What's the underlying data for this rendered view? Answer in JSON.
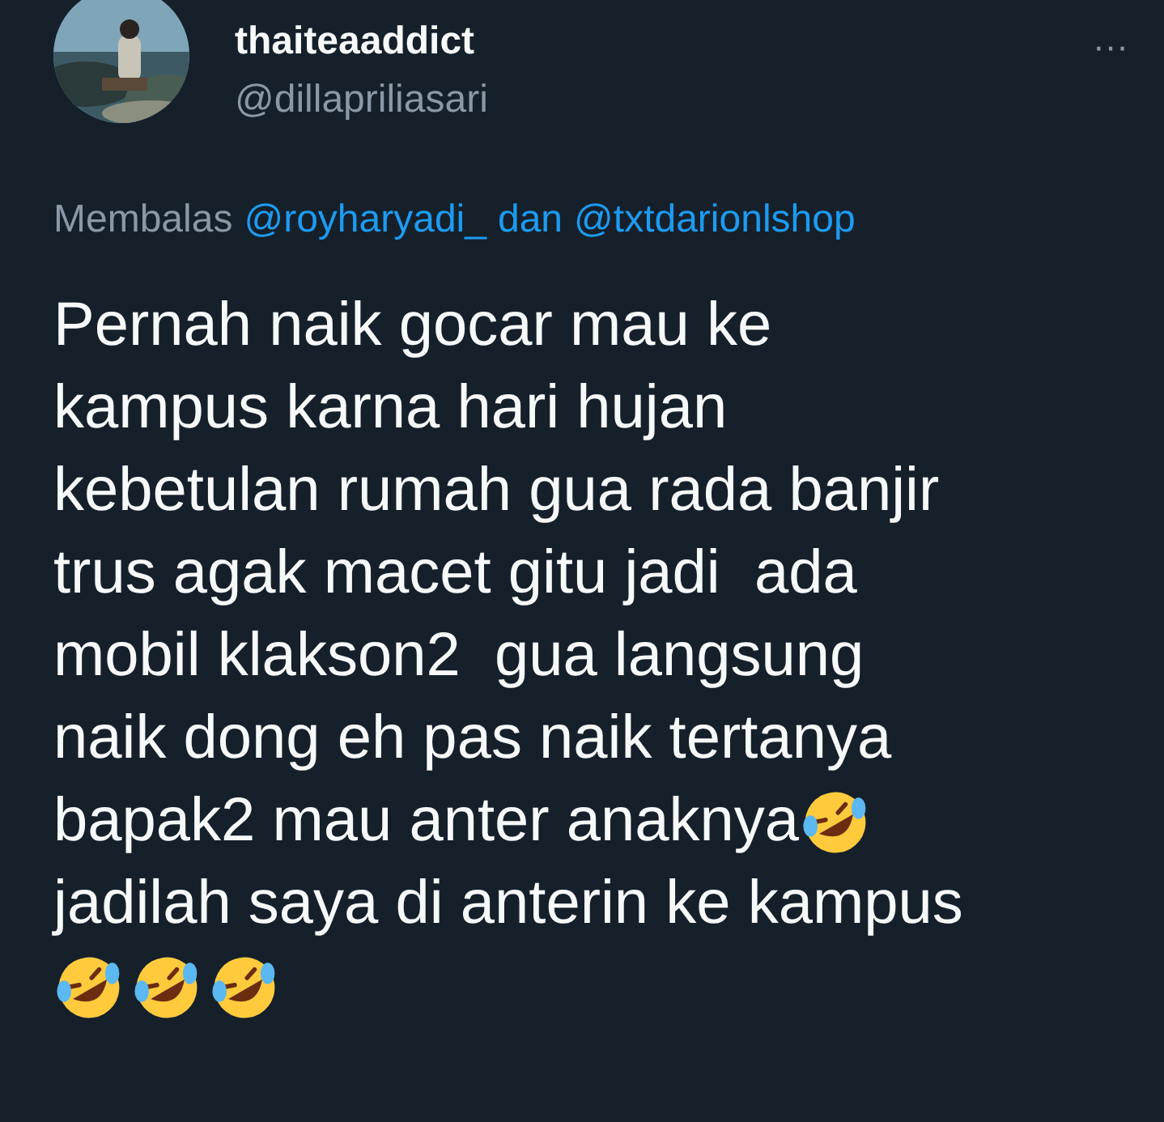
{
  "author": {
    "name": "thaiteaaddict",
    "handle": "@dillapriliasari",
    "more": "···"
  },
  "reply_to": {
    "prefix": "Membalas",
    "mentions": [
      "@royharyadi_",
      "@txtdarionlshop"
    ],
    "joiner": "dan"
  },
  "body": [
    [
      {
        "kind": "text",
        "text": "Pernah naik gocar mau ke"
      }
    ],
    [
      {
        "kind": "text",
        "text": "kampus karna hari hujan"
      }
    ],
    [
      {
        "kind": "text",
        "text": "kebetulan rumah gua rada banjir"
      }
    ],
    [
      {
        "kind": "text",
        "text": "trus agak macet gitu jadi  ada"
      }
    ],
    [
      {
        "kind": "text",
        "text": "mobil klakson2  gua langsung"
      }
    ],
    [
      {
        "kind": "text",
        "text": "naik dong eh pas naik tertanya"
      }
    ],
    [
      {
        "kind": "text",
        "text": "bapak2 mau anter anaknya"
      },
      {
        "kind": "emoji"
      }
    ],
    [
      {
        "kind": "text",
        "text": "jadilah saya di anterin ke kampus"
      }
    ],
    [
      {
        "kind": "emoji"
      },
      {
        "kind": "emoji"
      },
      {
        "kind": "emoji"
      }
    ]
  ]
}
